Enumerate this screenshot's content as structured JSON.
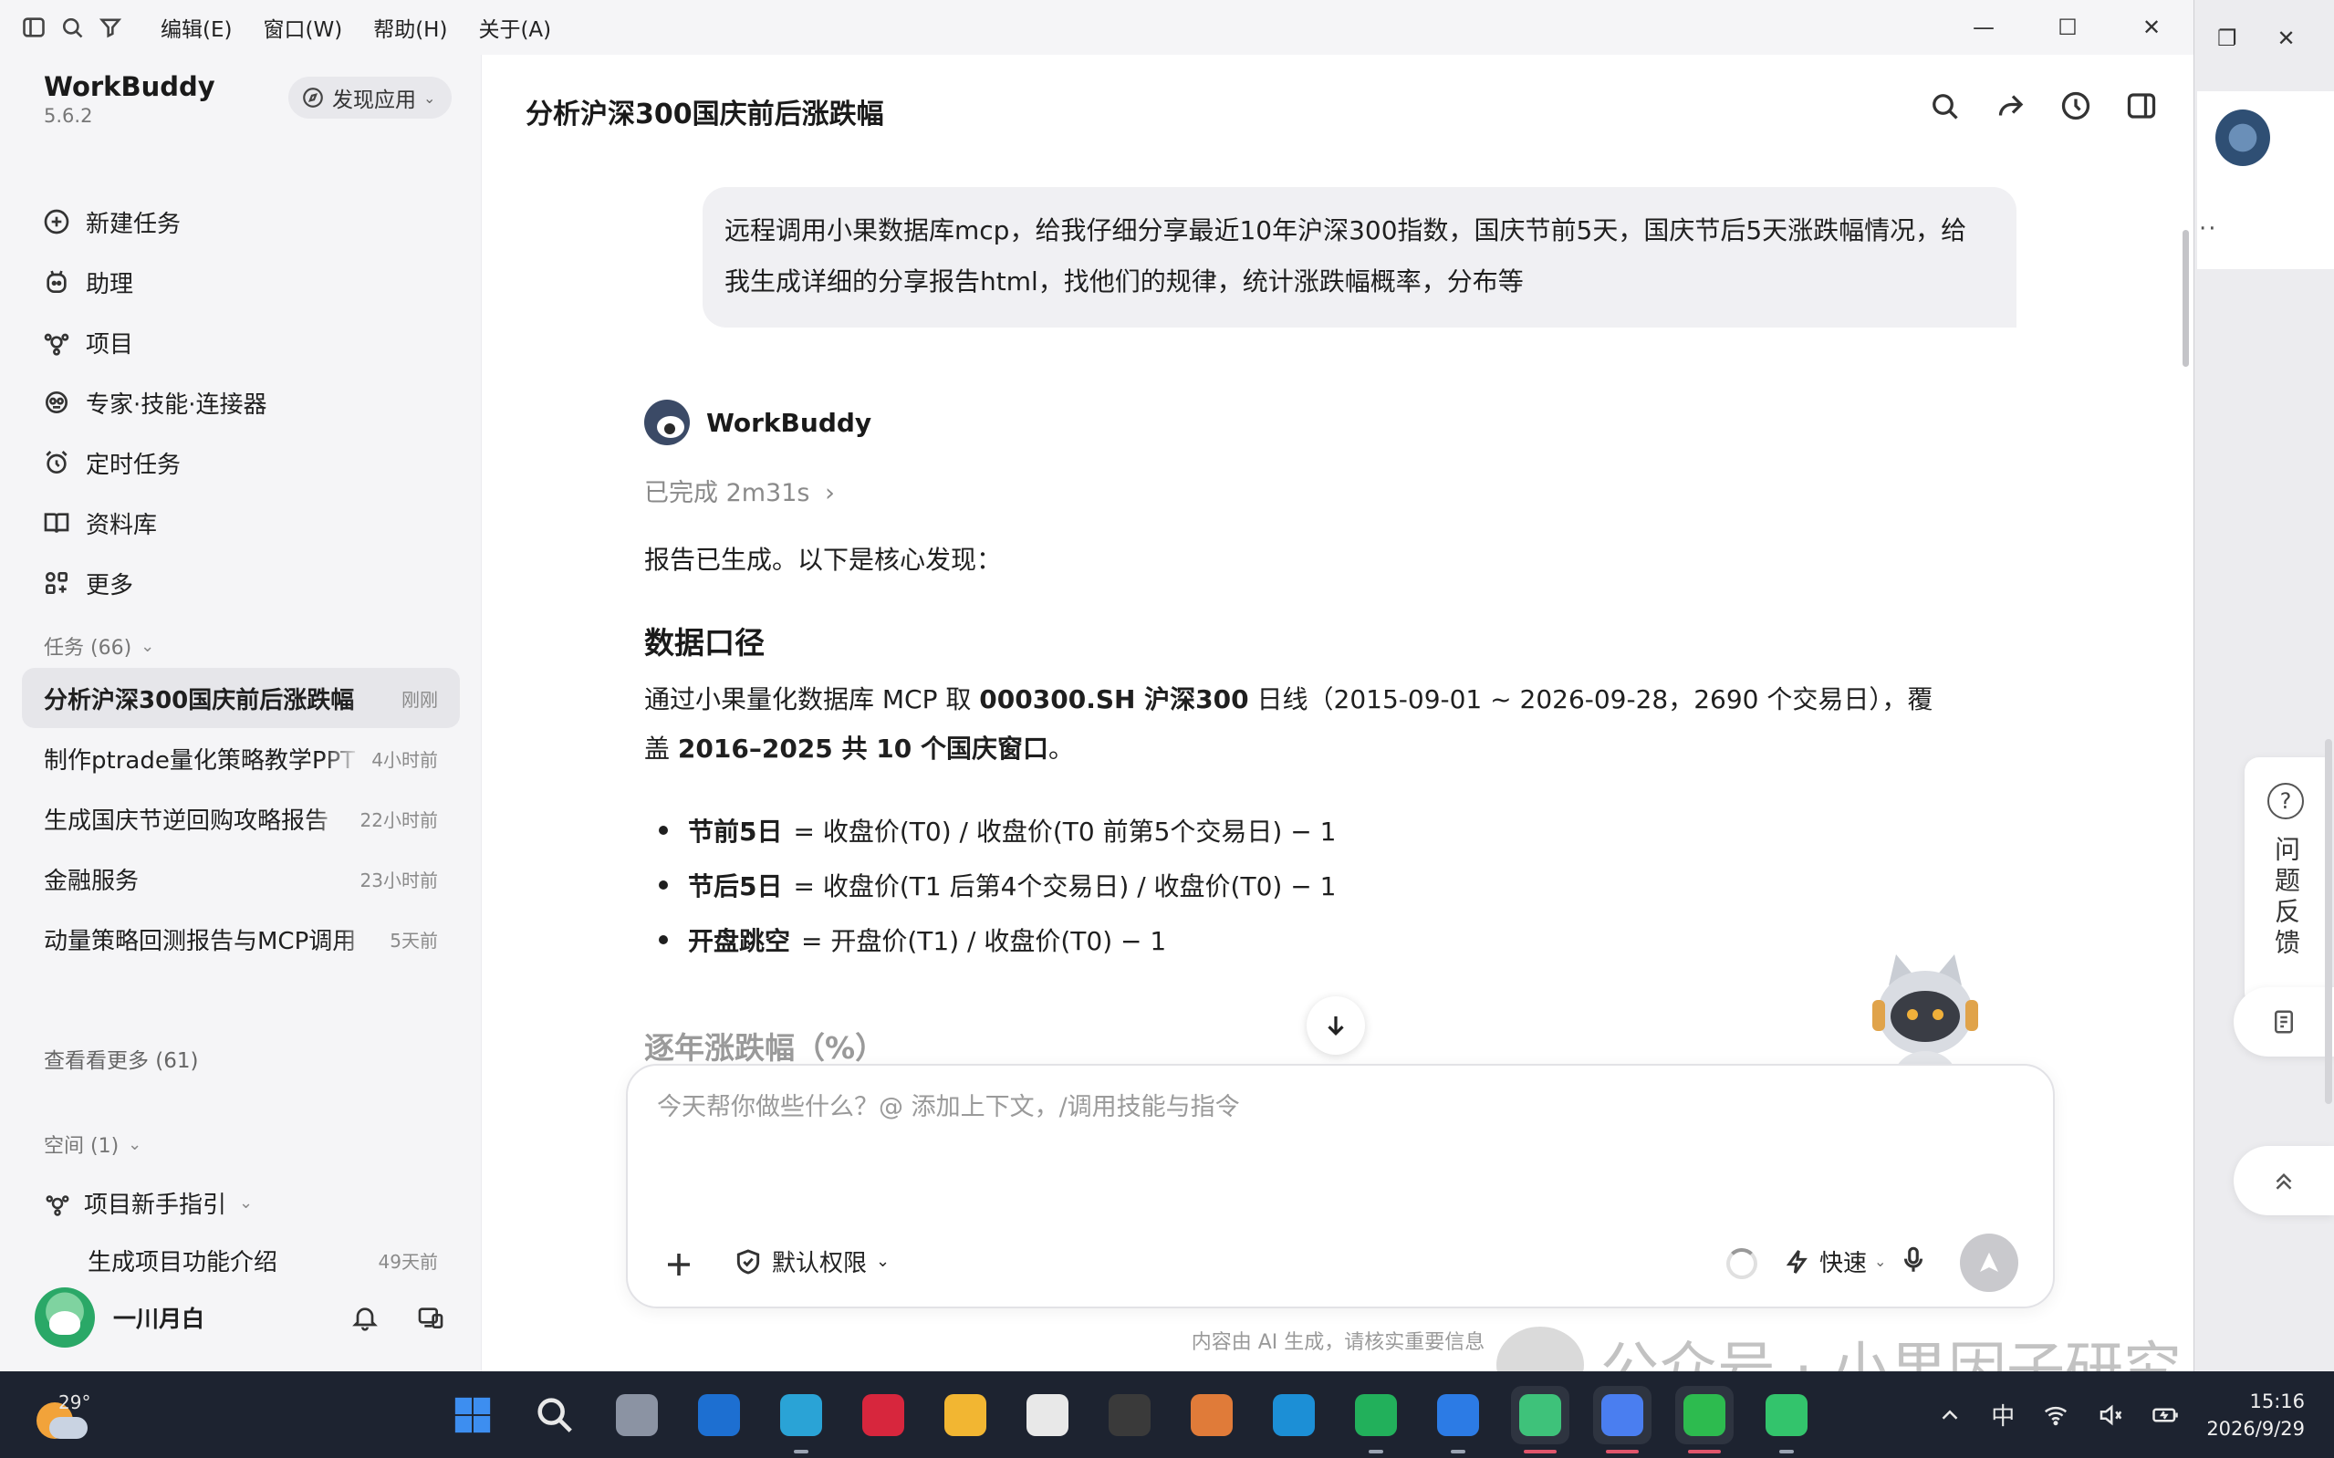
{
  "menubar": {
    "items": [
      "编辑(E)",
      "窗口(W)",
      "帮助(H)",
      "关于(A)"
    ],
    "icons": [
      "sidebar-toggle-icon",
      "search-icon",
      "filter-icon"
    ]
  },
  "window_controls": {
    "minimize": "—",
    "maximize": "☐",
    "close": "✕"
  },
  "sidebar": {
    "brand": "WorkBuddy",
    "version": "5.6.2",
    "discover_label": "发现应用",
    "nav": [
      {
        "label": "新建任务",
        "icon": "plus-circle-icon"
      },
      {
        "label": "助理",
        "icon": "assistant-icon"
      },
      {
        "label": "项目",
        "icon": "project-icon"
      },
      {
        "label": "专家·技能·连接器",
        "icon": "expert-icon"
      },
      {
        "label": "定时任务",
        "icon": "alarm-icon"
      },
      {
        "label": "资料库",
        "icon": "book-icon"
      },
      {
        "label": "更多",
        "icon": "more-grid-icon"
      }
    ],
    "tasks_header": "任务 (66)",
    "tasks": [
      {
        "title": "分析沪深300国庆前后涨跌幅",
        "time": "刚刚"
      },
      {
        "title": "制作ptrade量化策略教学PPT",
        "time": "4小时前"
      },
      {
        "title": "生成国庆节逆回购攻略报告",
        "time": "22小时前"
      },
      {
        "title": "金融服务",
        "time": "23小时前"
      },
      {
        "title": "动量策略回测报告与MCP调用",
        "time": "5天前"
      }
    ],
    "see_more": "查看看更多 (61)",
    "space_header": "空间 (1)",
    "space_project": "项目新手指引",
    "space_task": {
      "title": "生成项目功能介绍",
      "time": "49天前"
    },
    "user_name": "一川月白"
  },
  "main": {
    "title": "分析沪深300国庆前后涨跌幅",
    "user_message": "远程调用小果数据库mcp，给我仔细分享最近10年沪深300指数，国庆节前5天，国庆节后5天涨跌幅情况，给我生成详细的分享报告html，找他们的规律，统计涨跌幅概率，分布等",
    "bot_name": "WorkBuddy",
    "status": "已完成 2m31s",
    "status_chevron": "›",
    "intro": "报告已生成。以下是核心发现：",
    "data_heading": "数据口径",
    "data_para": {
      "p1": "通过小果量化数据库 MCP 取 ",
      "b1": "000300.SH 沪深300",
      "p2": " 日线（2015-09-01 ~ 2026-09-28，2690 个交易日），覆盖 ",
      "b2": "2016–2025 共 10 个国庆窗口",
      "p3": "。"
    },
    "formulas": [
      {
        "term": "节前5日",
        "expr": "= 收盘价(T0) / 收盘价(T0 前第5个交易日) − 1"
      },
      {
        "term": "节后5日",
        "expr": "= 收盘价(T1 后第4个交易日) / 收盘价(T0) − 1"
      },
      {
        "term": "开盘跳空",
        "expr": "= 开盘价(T1) / 收盘价(T0) − 1"
      }
    ],
    "yearly_heading": "逐年涨跌幅（%）",
    "composer_placeholder": "今天帮你做些什么？@ 添加上下文，/调用技能与指令",
    "permission_label": "默认权限",
    "speed_label": "快速",
    "disclaimer": "内容由 AI 生成，请核实重要信息"
  },
  "right_panel": {
    "feedback_label": "问题反馈",
    "help_glyph": "?",
    "dots": "··"
  },
  "watermark": "公众号 · 小果因子研究",
  "taskbar": {
    "temperature": "29°",
    "apps": [
      {
        "name": "start-icon",
        "color": "#3d8ef0"
      },
      {
        "name": "search-icon",
        "color": "#1d2330"
      },
      {
        "name": "task-view-icon",
        "color": "#8b93a3"
      },
      {
        "name": "outlook-icon",
        "color": "#1d6fd1"
      },
      {
        "name": "edge-icon",
        "color": "#2aa3d6"
      },
      {
        "name": "wps-icon",
        "color": "#d7263d"
      },
      {
        "name": "file-explorer-icon",
        "color": "#f2b632"
      },
      {
        "name": "store-icon",
        "color": "#e8e8e8"
      },
      {
        "name": "unity-icon",
        "color": "#3a3a3a"
      },
      {
        "name": "paint-icon",
        "color": "#e07b39"
      },
      {
        "name": "edge-ai-icon",
        "color": "#1c8fd6"
      },
      {
        "name": "messaging-icon",
        "color": "#22b05b"
      },
      {
        "name": "trading-app-icon",
        "color": "#2c7be5"
      },
      {
        "name": "workbuddy-icon",
        "color": "#3ec27a"
      },
      {
        "name": "search-app-icon",
        "color": "#4a7ef0"
      },
      {
        "name": "wechat-icon",
        "color": "#2dbb4f"
      },
      {
        "name": "chat-app-icon",
        "color": "#33c46c"
      }
    ],
    "ime": "中",
    "time": "15:16",
    "date": "2026/9/29"
  }
}
